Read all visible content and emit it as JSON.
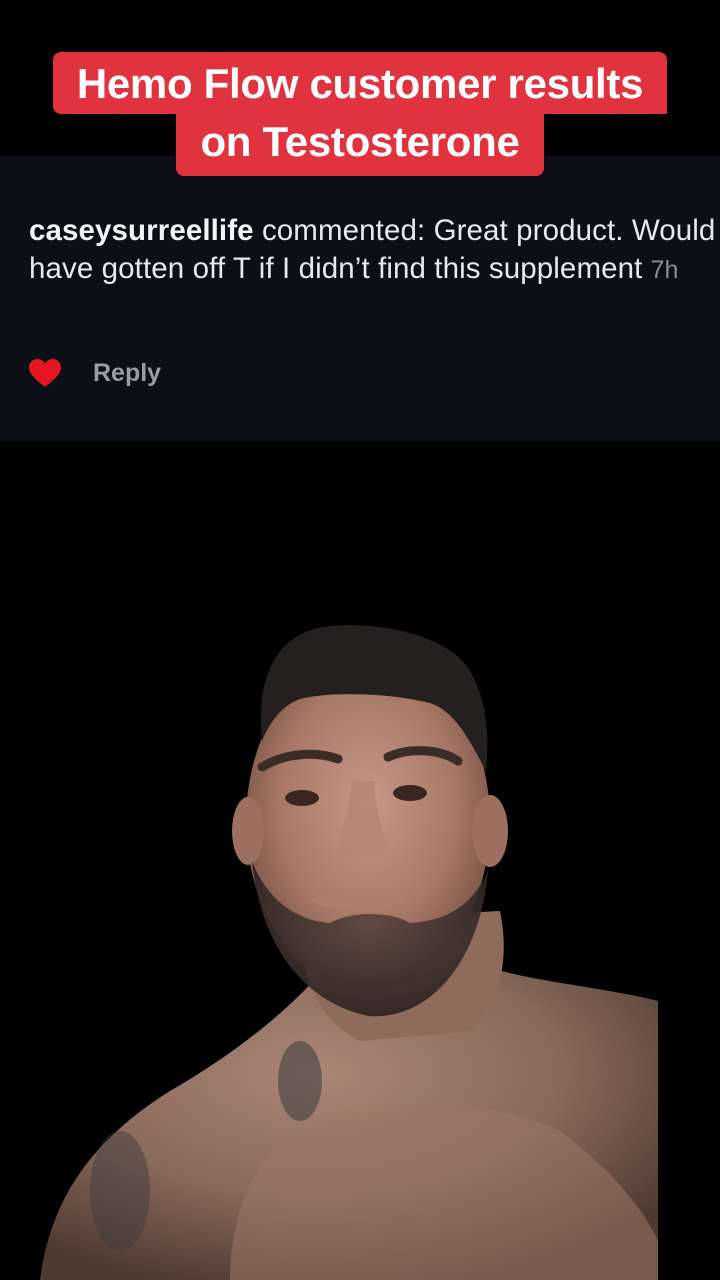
{
  "caption": {
    "line1": "Hemo Flow customer results",
    "line2": "on Testosterone",
    "background_color": "#e0333f"
  },
  "comment": {
    "username": "caseysurreellife",
    "verb": "commented:",
    "text": "Great product. Would have gotten off T if I didn’t find this supplement",
    "time": "7h",
    "liked": true,
    "like_icon": "heart-icon",
    "like_color": "#e5161f",
    "reply_label": "Reply"
  },
  "video": {
    "subject": "person-video"
  }
}
